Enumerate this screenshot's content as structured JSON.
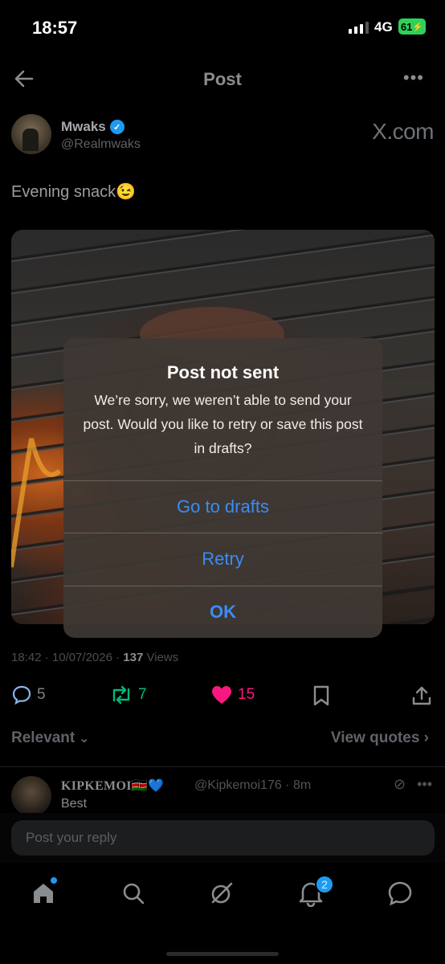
{
  "status_bar": {
    "time": "18:57",
    "network": "4G",
    "battery": "61"
  },
  "nav": {
    "title": "Post"
  },
  "post": {
    "author_name": "Mwaks",
    "author_handle": "@Realmwaks",
    "source": "X.com",
    "text": "Evening snack😉",
    "meta_time": "18:42 · 10/07/2026 · ",
    "views_count": "137",
    "views_label": " Views",
    "reply_count": "5",
    "repost_count": "7",
    "like_count": "15"
  },
  "replies_header": {
    "filter_label": "Relevant",
    "quotes_label": "View quotes"
  },
  "reply": {
    "author_name": "KIPKEMOI🇰🇪💙",
    "author_handle": "@Kipkemoi176 · 8m",
    "text": "Best"
  },
  "reply_box": {
    "placeholder": "Post your reply"
  },
  "tabbar": {
    "notification_count": "2"
  },
  "alert": {
    "title": "Post not sent",
    "message": "We’re sorry, we weren’t able to send your post. Would you like to retry or save this post in drafts?",
    "drafts_label": "Go to drafts",
    "retry_label": "Retry",
    "ok_label": "OK"
  },
  "colors": {
    "accent": "#1d9bf0",
    "like": "#f91880",
    "repost": "#00ba7c",
    "alert_button": "#3b8cf5"
  }
}
